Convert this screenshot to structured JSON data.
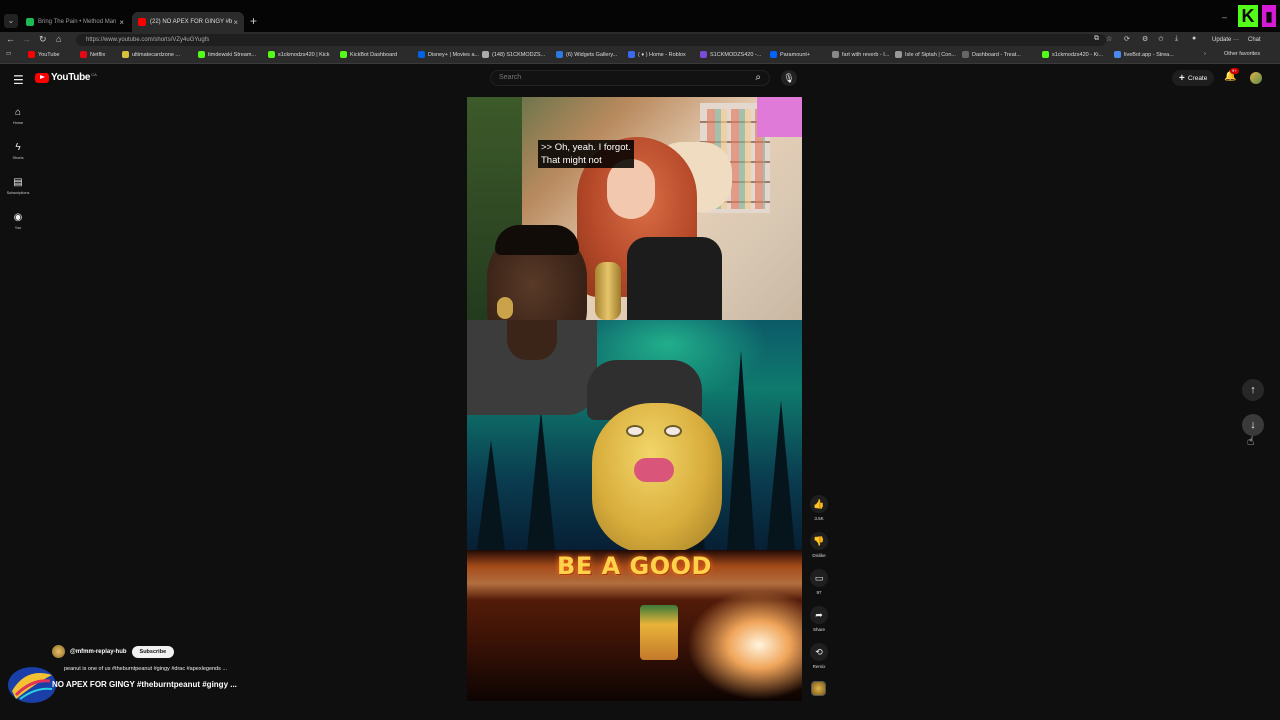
{
  "browser": {
    "tabs": [
      {
        "title": "Bring The Pain • Method Man",
        "active": false
      },
      {
        "title": "(22) NO APEX FOR GINGY #b",
        "active": true
      }
    ],
    "url": "https://www.youtube.com/shorts/VZy4uGYugfs",
    "update_label": "Update",
    "chat_label": "Chat",
    "bookmarks": [
      "YouTube",
      "Netflix",
      "ultimatecardzone ...",
      "timdewski Stream...",
      "s1ckmodzs420 | Kick",
      "KickBot Dashboard",
      "Disney+ | Movies a...",
      "(148) S1CKMODZS...",
      "(6) Widgets Gallery...",
      "( ♦ ) Home - Roblox",
      "S1CKMODZS420 -...",
      "Paramount+",
      "fart with reverb - I...",
      "Isle of Siptah | Con...",
      "Dashboard - Treat...",
      "s1ckmodzs420 - Ki...",
      "liveBot.app - Strea..."
    ],
    "other_favorites": "Other favorites"
  },
  "youtube": {
    "logo_text": "YouTube",
    "country_code": "CA",
    "search_placeholder": "Search",
    "create_label": "Create",
    "notification_count": "9+",
    "guide": [
      {
        "icon": "home-icon",
        "label": "Home"
      },
      {
        "icon": "shorts-icon",
        "label": "Shorts"
      },
      {
        "icon": "subscriptions-icon",
        "label": "Subscriptions"
      },
      {
        "icon": "you-icon",
        "label": "You"
      }
    ]
  },
  "short": {
    "caption_line1": ">> Oh, yeah. I forgot.",
    "caption_line2": "That might not",
    "overlay_text": "BE A GOOD",
    "channel_handle": "@mfmm-replay-hub",
    "subscribe_label": "Subscribe",
    "description": "peanut is one of us #theburntpeanut #gingy #drac #apexlegends ...",
    "title": "NO APEX FOR GINGY #theburntpeanut #gingy ..."
  },
  "actions": {
    "like_count": "3.5K",
    "dislike_label": "Dislike",
    "comment_count": "97",
    "share_label": "Share",
    "remix_label": "Remix"
  },
  "colors": {
    "background": "#0f0f0f",
    "youtube_red": "#ff0000",
    "kick_green": "#53fc18"
  }
}
